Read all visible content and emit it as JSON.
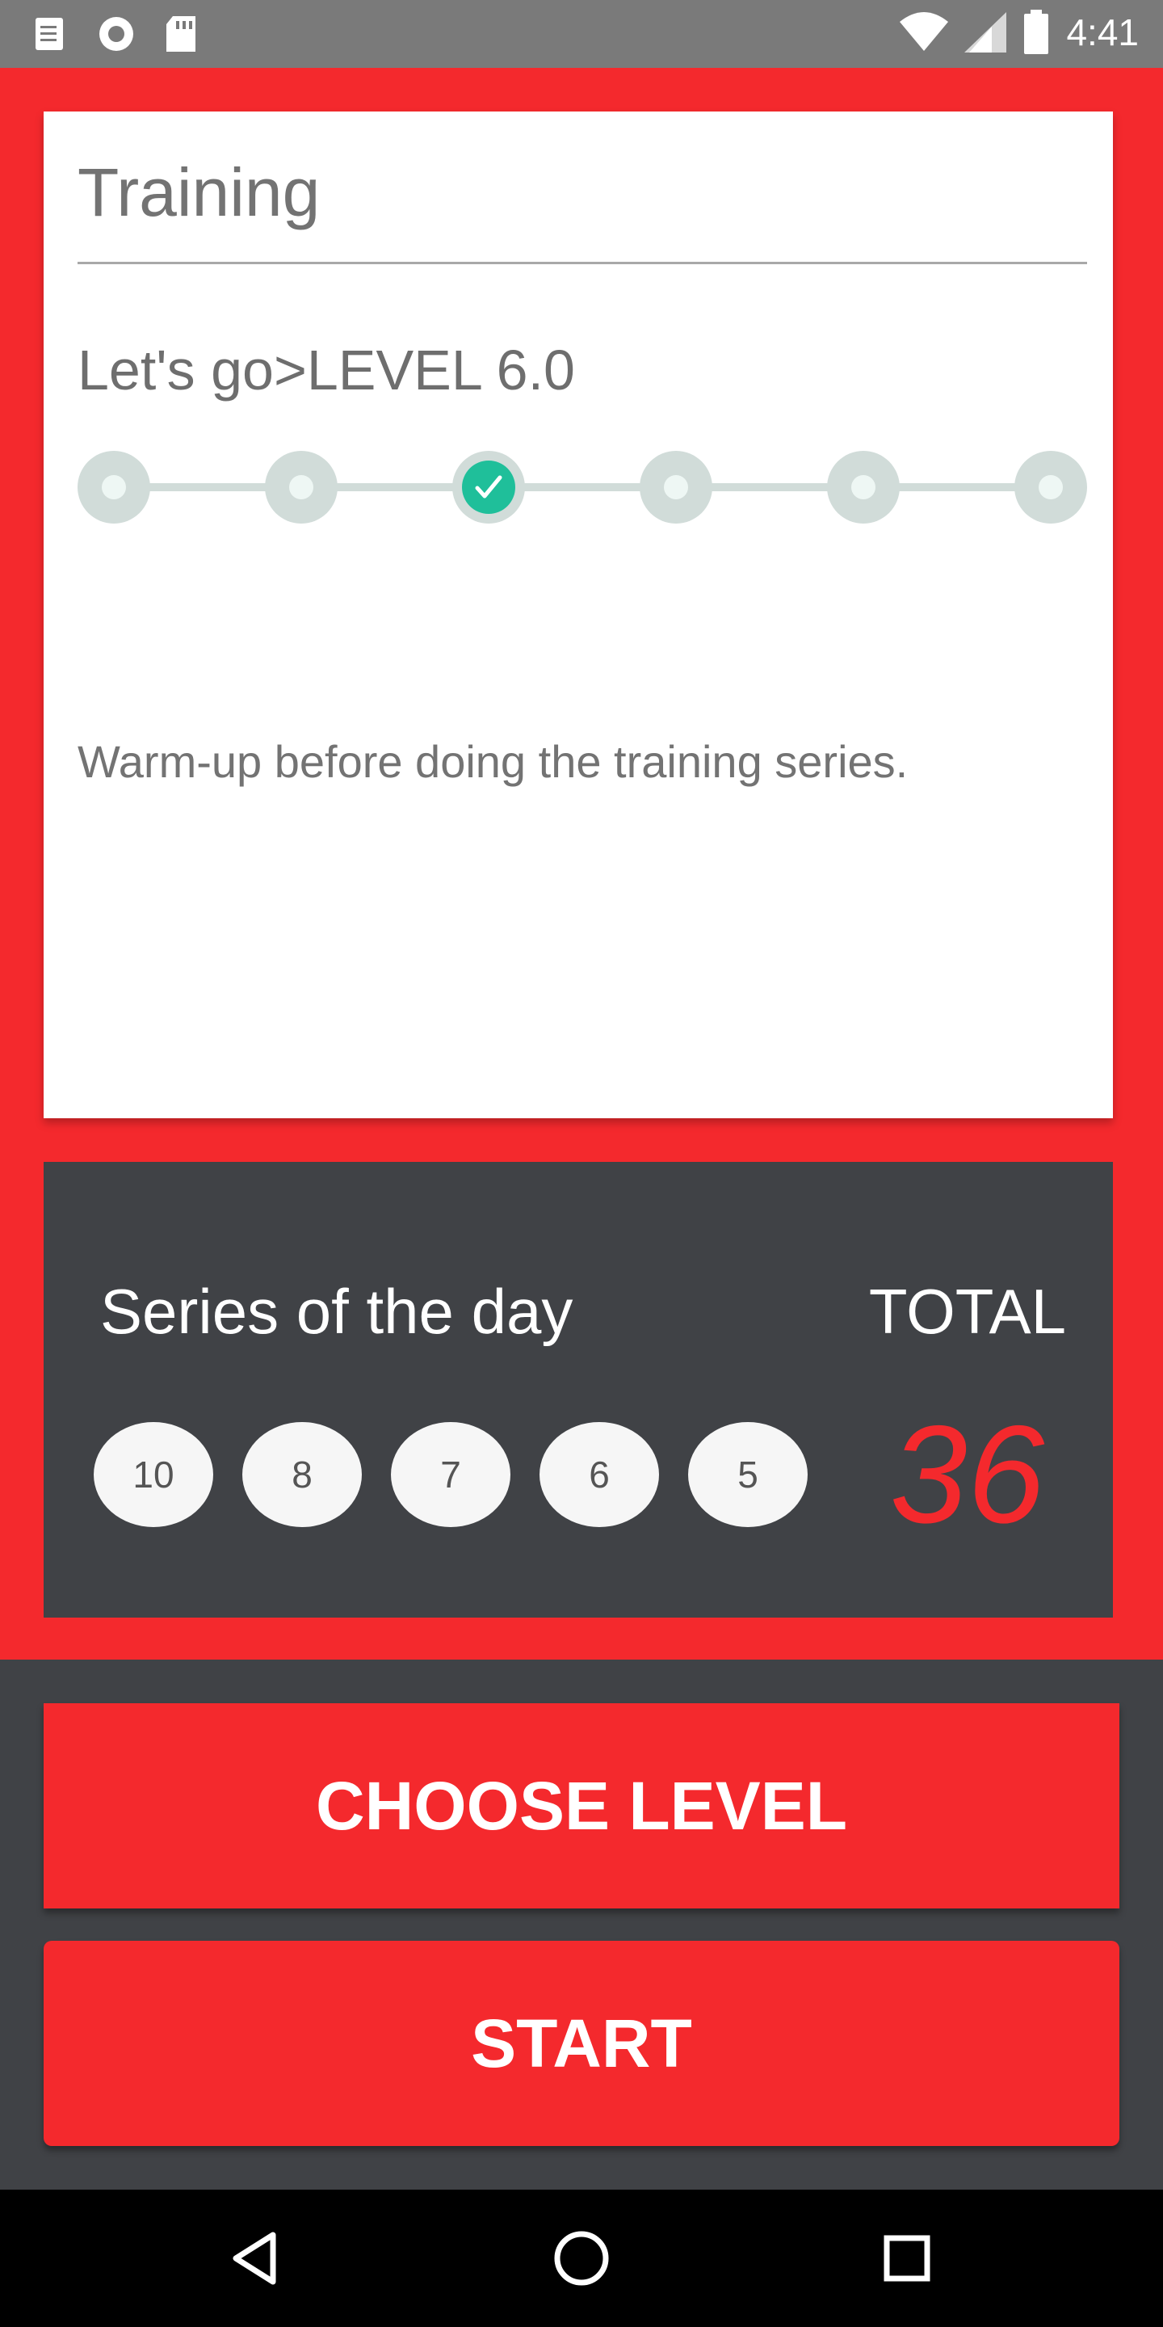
{
  "status_bar": {
    "time": "4:41",
    "icons": [
      "notes-icon",
      "record-icon",
      "sd-card-icon",
      "wifi-icon",
      "signal-icon",
      "battery-icon"
    ]
  },
  "card": {
    "title": "Training",
    "level_text": "Let's go>LEVEL 6.0",
    "steps": {
      "count": 6,
      "active_index": 2
    },
    "instruction": "Warm-up before doing the training series."
  },
  "series_panel": {
    "title": "Series of the day",
    "total_label": "TOTAL",
    "series": [
      "10",
      "8",
      "7",
      "6",
      "5"
    ],
    "total_value": "36"
  },
  "buttons": {
    "choose_level": "CHOOSE LEVEL",
    "start": "START"
  },
  "colors": {
    "accent_red": "#f4292d",
    "dark_panel": "#404246",
    "step_active": "#1fbf9a",
    "step_inactive": "#d1dcd9"
  },
  "nav_bar": {
    "icons": [
      "back-icon",
      "home-icon",
      "recents-icon"
    ]
  }
}
